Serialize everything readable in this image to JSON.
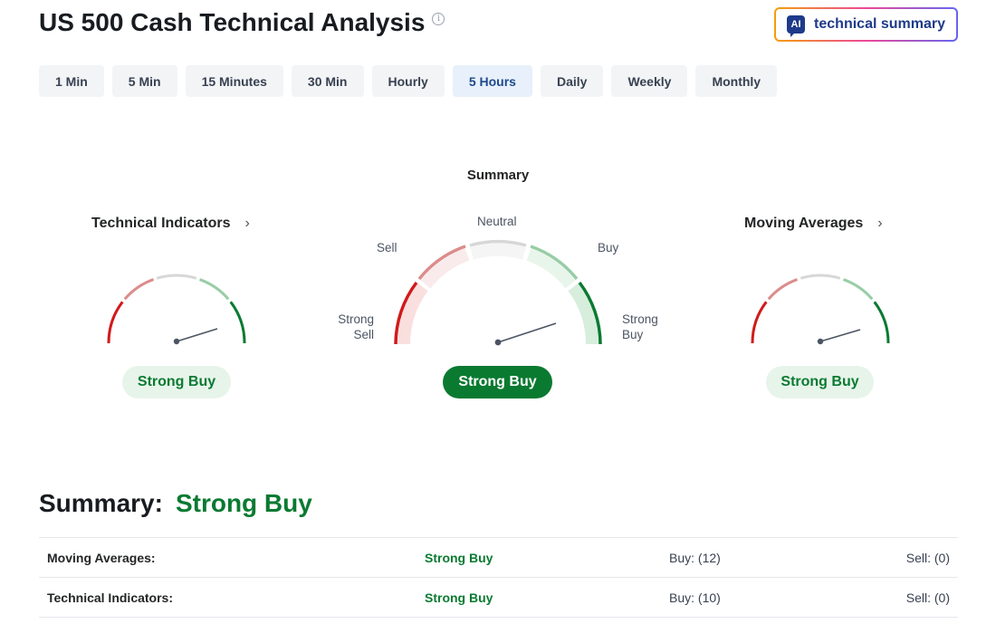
{
  "header": {
    "title": "US 500 Cash Technical Analysis",
    "info_glyph": "i",
    "ai_button": {
      "badge": "AI",
      "label": "technical summary"
    }
  },
  "tabs": [
    {
      "label": "1 Min",
      "active": false
    },
    {
      "label": "5 Min",
      "active": false
    },
    {
      "label": "15 Minutes",
      "active": false
    },
    {
      "label": "30 Min",
      "active": false
    },
    {
      "label": "Hourly",
      "active": false
    },
    {
      "label": "5 Hours",
      "active": true
    },
    {
      "label": "Daily",
      "active": false
    },
    {
      "label": "Weekly",
      "active": false
    },
    {
      "label": "Monthly",
      "active": false
    }
  ],
  "gauges": {
    "heading": "Summary",
    "technical_indicators": {
      "title": "Technical Indicators",
      "value": "Strong Buy"
    },
    "summary": {
      "value": "Strong Buy",
      "labels": {
        "strong_sell_1": "Strong",
        "strong_sell_2": "Sell",
        "sell": "Sell",
        "neutral": "Neutral",
        "buy": "Buy",
        "strong_buy_1": "Strong",
        "strong_buy_2": "Buy"
      }
    },
    "moving_averages": {
      "title": "Moving Averages",
      "value": "Strong Buy"
    },
    "chevron": "›"
  },
  "summary": {
    "label": "Summary:",
    "value": "Strong Buy",
    "rows": [
      {
        "name": "Moving Averages:",
        "signal": "Strong Buy",
        "buy": "Buy: (12)",
        "sell": "Sell: (0)"
      },
      {
        "name": "Technical Indicators:",
        "signal": "Strong Buy",
        "buy": "Buy: (10)",
        "sell": "Sell: (0)"
      }
    ]
  },
  "colors": {
    "strong_sell": "#d11a1a",
    "sell": "#dc8c8c",
    "neutral": "#d7d7d7",
    "buy": "#98cda6",
    "strong_buy": "#0a7a31"
  }
}
